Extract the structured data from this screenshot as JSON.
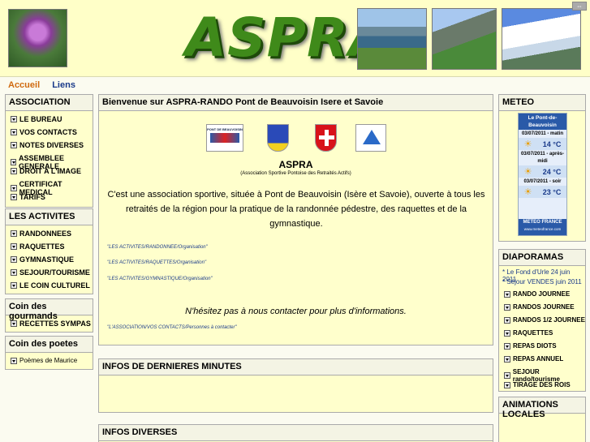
{
  "header": {
    "logo": "ASPRA"
  },
  "topnav": {
    "home": "Accueil",
    "links": "Liens"
  },
  "sidebar": {
    "association": {
      "title": "ASSOCIATION",
      "items": [
        "LE BUREAU",
        "VOS CONTACTS",
        "NOTES DIVERSES",
        "ASSEMBLEE GENERALE",
        "DROIT A L'IMAGE",
        "CERTIFICAT MEDICAL",
        "TARIFS"
      ]
    },
    "activites": {
      "title": "LES ACTIVITES",
      "items": [
        "RANDONNEES",
        "RAQUETTES",
        "GYMNASTIQUE",
        "SEJOUR/TOURISME",
        "LE COIN CULTUREL"
      ]
    },
    "gourmands": {
      "title": "Coin des gourmands",
      "items": [
        "RECETTES SYMPAS"
      ]
    },
    "poetes": {
      "title": "Coin des poetes",
      "items": [
        "Poèmes de Maurice"
      ]
    }
  },
  "main": {
    "welcome_title": "Bienvenue sur ASPRA-RANDO Pont de Beauvoisin Isere et Savoie",
    "logo_pont": "PONT DE BEAUVOISIN",
    "heading": "ASPRA",
    "subheading": "(Association Sportive Pontoise des Retraités Actifs)",
    "intro": "C'est une association sportive, située à Pont de Beauvoisin (Isère et Savoie), ouverte à tous les retraités de la région pour la pratique de la randonnée pédestre, des raquettes et de la gymnastique.",
    "links": [
      "\"LES ACTIVITES/RANDONNEE/Organisation\"",
      "\"LES ACTIVITES/RAQUETTES/Organisation\"",
      "\"LES ACTIVITES/GYMNASTIQUE/Organisation\""
    ],
    "contact": "N'hésitez pas à nous contacter pour plus d'informations.",
    "contact_link": "\"L'ASSOCIATION/VOS CONTACTS/Personnes à contacter\"",
    "infos_dernieres": "INFOS DE DERNIERES MINUTES",
    "infos_diverses": "INFOS DIVERSES"
  },
  "meteo": {
    "title": "METEO",
    "location": "Le Pont-de-Beauvoisin",
    "slots": [
      {
        "label": "03/07/2011 - matin",
        "temp": "14 °C"
      },
      {
        "label": "03/07/2011 - après-midi",
        "temp": "24 °C"
      },
      {
        "label": "03/07/2011 - soir",
        "temp": "23 °C"
      }
    ],
    "brand": "METEO FRANCE",
    "brand_sub": "www.meteofrance.com"
  },
  "diaporamas": {
    "title": "DIAPORAMAS",
    "links": [
      "* Le Fond d'Urle 24 juin 2011",
      "* Séjour VENDES juin 2011"
    ],
    "items": [
      "RANDO JOURNEE",
      "RANDOS JOURNEE",
      "RANDOS 1/2 JOURNEE",
      "RAQUETTES",
      "REPAS DIOTS",
      "REPAS ANNUEL",
      "SEJOUR rando/tourisme",
      "TIRAGE DES ROIS"
    ]
  },
  "animations": {
    "title": "ANIMATIONS LOCALES"
  },
  "colors": {
    "banner": "#ffffc8",
    "box_bg": "#ffffcc",
    "logo_green": "#3f8a1a",
    "nav_orange": "#d06a10",
    "link_blue": "#1a3a8a"
  }
}
